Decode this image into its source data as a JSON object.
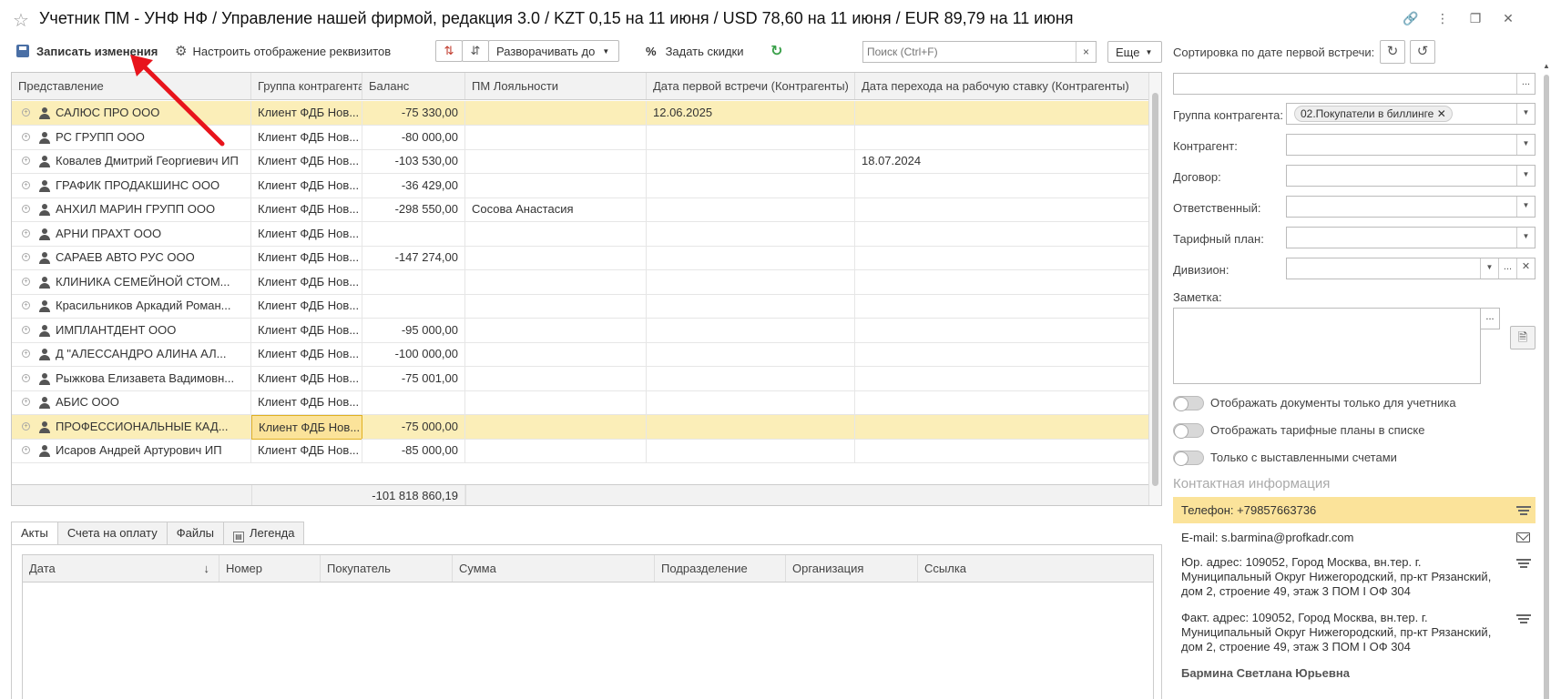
{
  "window": {
    "title": "Учетник ПМ - УНФ НФ / Управление нашей фирмой, редакция 3.0 / KZT 0,15 на 11 июня / USD 78,60 на 11 июня / EUR 89,79 на 11 июня"
  },
  "toolbar": {
    "save_label": "Записать изменения",
    "configure_label": "Настроить отображение реквизитов",
    "expand_label": "Разворачивать до",
    "discount_label": "Задать скидки",
    "search_placeholder": "Поиск (Ctrl+F)",
    "more_label": "Еще",
    "clear_symbol": "×",
    "percent_symbol": "%"
  },
  "grid": {
    "columns": [
      "Представление",
      "Группа контрагента",
      "Баланс",
      "ПМ Лояльности",
      "Дата первой встречи (Контрагенты)",
      "Дата перехода на рабочую ставку (Контрагенты)"
    ],
    "rows": [
      {
        "name": "САЛЮС ПРО ООО",
        "group": "Клиент ФДБ Нов...",
        "balance": "-75 330,00",
        "loyalty": "",
        "first_meeting": "12.06.2025",
        "transition": "",
        "highlight": true
      },
      {
        "name": "РС ГРУПП ООО",
        "group": "Клиент ФДБ Нов...",
        "balance": "-80 000,00",
        "loyalty": "",
        "first_meeting": "",
        "transition": ""
      },
      {
        "name": "Ковалев Дмитрий Георгиевич ИП",
        "group": "Клиент ФДБ Нов...",
        "balance": "-103 530,00",
        "loyalty": "",
        "first_meeting": "",
        "transition": "18.07.2024"
      },
      {
        "name": "ГРАФИК ПРОДАКШИНС ООО",
        "group": "Клиент ФДБ Нов...",
        "balance": "-36 429,00",
        "loyalty": "",
        "first_meeting": "",
        "transition": ""
      },
      {
        "name": "АНХИЛ МАРИН ГРУПП ООО",
        "group": "Клиент ФДБ Нов...",
        "balance": "-298 550,00",
        "loyalty": "Сосова Анастасия",
        "first_meeting": "",
        "transition": ""
      },
      {
        "name": "АРНИ ПРАХТ ООО",
        "group": "Клиент ФДБ Нов...",
        "balance": "",
        "loyalty": "",
        "first_meeting": "",
        "transition": ""
      },
      {
        "name": "САРАЕВ АВТО РУС ООО",
        "group": "Клиент ФДБ Нов...",
        "balance": "-147 274,00",
        "loyalty": "",
        "first_meeting": "",
        "transition": ""
      },
      {
        "name": "КЛИНИКА СЕМЕЙНОЙ СТОМ...",
        "group": "Клиент ФДБ Нов...",
        "balance": "",
        "loyalty": "",
        "first_meeting": "",
        "transition": ""
      },
      {
        "name": "Красильников Аркадий Роман...",
        "group": "Клиент ФДБ Нов...",
        "balance": "",
        "loyalty": "",
        "first_meeting": "",
        "transition": ""
      },
      {
        "name": "ИМПЛАНТДЕНТ ООО",
        "group": "Клиент ФДБ Нов...",
        "balance": "-95 000,00",
        "loyalty": "",
        "first_meeting": "",
        "transition": ""
      },
      {
        "name": "Д \"АЛЕССАНДРО АЛИНА АЛ...",
        "group": "Клиент ФДБ Нов...",
        "balance": "-100 000,00",
        "loyalty": "",
        "first_meeting": "",
        "transition": ""
      },
      {
        "name": "Рыжкова Елизавета Вадимовн...",
        "group": "Клиент ФДБ Нов...",
        "balance": "-75 001,00",
        "loyalty": "",
        "first_meeting": "",
        "transition": ""
      },
      {
        "name": "АБИС ООО",
        "group": "Клиент ФДБ Нов...",
        "balance": "",
        "loyalty": "",
        "first_meeting": "",
        "transition": ""
      },
      {
        "name": "ПРОФЕССИОНАЛЬНЫЕ КАД...",
        "group": "Клиент ФДБ Нов...",
        "balance": "-75 000,00",
        "loyalty": "",
        "first_meeting": "",
        "transition": "",
        "highlight": true,
        "selected": true
      },
      {
        "name": "Исаров Андрей Артурович ИП",
        "group": "Клиент ФДБ Нов...",
        "balance": "-85 000,00",
        "loyalty": "",
        "first_meeting": "",
        "transition": ""
      }
    ],
    "total_balance": "-101 818 860,19"
  },
  "bottom_tabs": [
    "Акты",
    "Счета на оплату",
    "Файлы",
    "Легенда"
  ],
  "bottom_grid": {
    "columns": [
      "Дата",
      "Номер",
      "Покупатель",
      "Сумма",
      "Подразделение",
      "Организация",
      "Ссылка"
    ],
    "sort_symbol": "↓"
  },
  "right_panel": {
    "sort_label": "Сортировка по дате первой встречи:",
    "group_label": "Группа контрагента:",
    "group_value": "02.Покупатели в биллинге",
    "counterparty_label": "Контрагент:",
    "contract_label": "Договор:",
    "responsible_label": "Ответственный:",
    "tariff_label": "Тарифный план:",
    "division_label": "Дивизион:",
    "note_label": "Заметка:",
    "toggle1": "Отображать документы только для учетника",
    "toggle2": "Отображать тарифные планы в списке",
    "toggle3": "Только с выставленными счетами",
    "contact_header": "Контактная информация",
    "phone": "Телефон: +79857663736",
    "email": "E-mail:  s.barmina@profkadr.com",
    "legal_address": "Юр. адрес: 109052, Город Москва, вн.тер. г. Муниципальный Округ Нижегородский, пр-кт Рязанский, дом 2, строение 49, этаж 3 ПОМ I ОФ 304",
    "actual_address": "Факт. адрес: 109052, Город Москва, вн.тер. г. Муниципальный Округ Нижегородский, пр-кт Рязанский, дом 2, строение 49, этаж 3 ПОМ I ОФ 304",
    "contact_person": "Бармина Светлана Юрьевна"
  },
  "colors": {
    "highlight_row": "#fbeeb8",
    "selected_cell": "#fbe39a",
    "arrow": "#e8141c",
    "refresh_green": "#3aa04a"
  }
}
